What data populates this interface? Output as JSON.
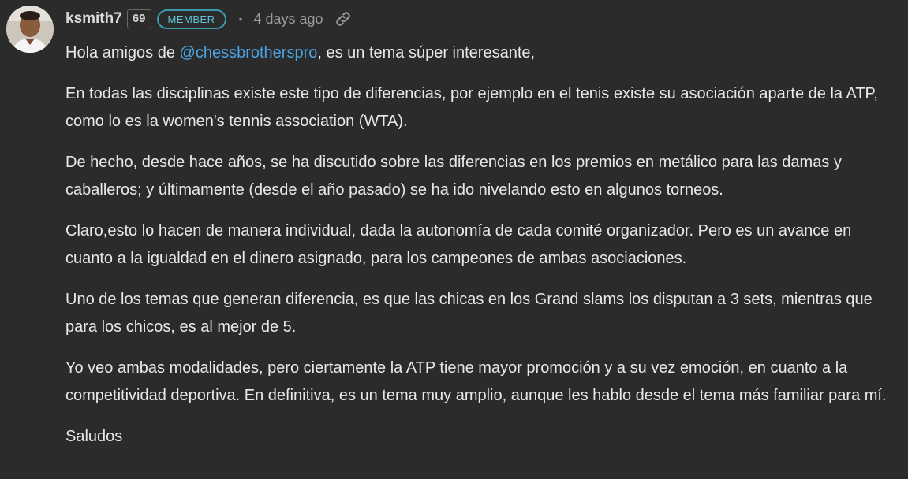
{
  "post": {
    "author": "ksmith7",
    "reputation": "69",
    "badge": "MEMBER",
    "separator": "•",
    "time_ago": "4 days ago",
    "icons": {
      "avatar": "user-avatar-photo",
      "permalink": "link-icon"
    },
    "colors": {
      "background": "#2b2b2b",
      "mention": "#4aa3e0",
      "badge": "#3a9bb0"
    },
    "paragraph1": {
      "before": "Hola amigos de ",
      "mention": "@chessbrotherspro",
      "after": ", es un tema súper interesante,"
    },
    "paragraphs": [
      "En todas las disciplinas existe este tipo de diferencias, por ejemplo en el tenis existe su asociación aparte de la ATP, como lo es la women's tennis association (WTA).",
      "De hecho, desde hace años, se ha discutido sobre las diferencias en los premios en metálico para las damas y caballeros; y últimamente (desde el año pasado) se ha ido nivelando esto en algunos torneos.",
      "Claro,esto lo hacen de manera individual, dada la autonomía de cada comité organizador. Pero es un avance en cuanto a la igualdad en el dinero asignado, para los campeones de ambas asociaciones.",
      "Uno de los temas que generan diferencia, es que las chicas en los Grand slams los disputan a 3 sets, mientras que para los chicos, es al mejor de 5.",
      "Yo veo ambas modalidades, pero ciertamente la ATP tiene mayor promoción y a su vez emoción, en cuanto a la competitividad deportiva. En definitiva, es un tema muy amplio, aunque les hablo desde el tema más familiar para mí.",
      "Saludos"
    ]
  }
}
